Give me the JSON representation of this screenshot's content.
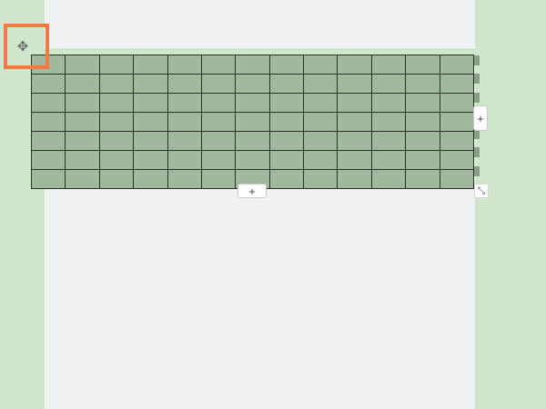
{
  "table": {
    "rows": 7,
    "columns": 13,
    "cell_fill": "#a0b89c",
    "border_color": "#2a332a"
  },
  "controls": {
    "move_handle_icon": "move-arrows-icon",
    "move_handle_glyph": "✥",
    "add_column_glyph": "+",
    "add_row_glyph": "+",
    "resize_icon": "resize-diagonal-icon",
    "resize_glyph": "⤡"
  },
  "colors": {
    "background": "#cfe6ca",
    "page": "#f0f1f3",
    "highlight": "#f07a45"
  }
}
